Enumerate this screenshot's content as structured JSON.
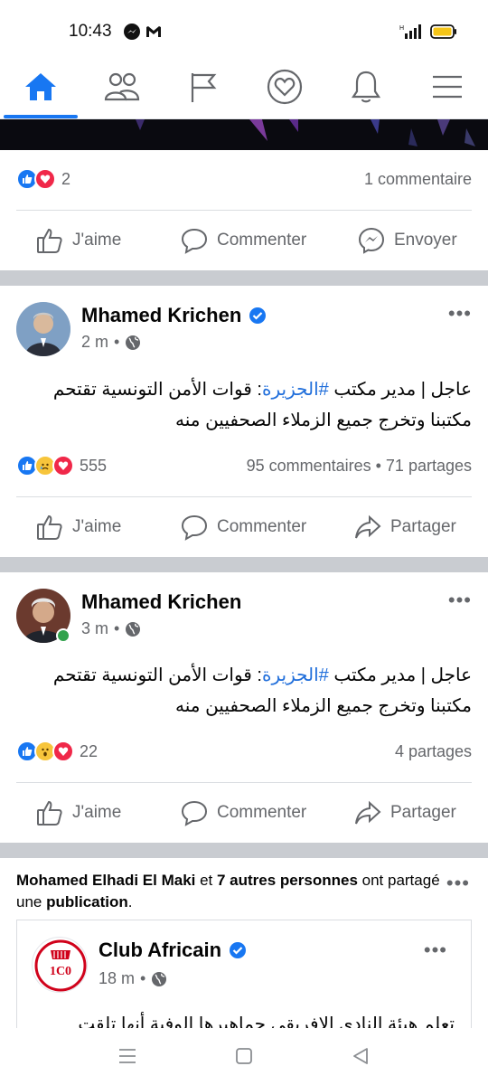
{
  "status_bar": {
    "time": "10:43"
  },
  "nav": {
    "items": [
      {
        "name": "home",
        "active": true
      },
      {
        "name": "friends",
        "active": false
      },
      {
        "name": "pages",
        "active": false
      },
      {
        "name": "dating",
        "active": false
      },
      {
        "name": "notifications",
        "active": false
      },
      {
        "name": "menu",
        "active": false
      }
    ]
  },
  "colors": {
    "accent": "#1877f2",
    "hashtag": "#216fdb",
    "muted": "#65676b",
    "divider": "#c9ccd1"
  },
  "post0": {
    "reaction_count": "2",
    "comments": "1 commentaire",
    "actions": {
      "like": "J'aime",
      "comment": "Commenter",
      "send": "Envoyer"
    }
  },
  "post1": {
    "author": "Mhamed Krichen",
    "verified": true,
    "time": "2 m",
    "sep": "•",
    "text_before": "عاجل | مدير مكتب ",
    "hashtag": "#الجزيرة",
    "text_after": ": قوات الأمن التونسية تقتحم مكتبنا وتخرج جميع الزملاء الصحفيين منه",
    "reaction_count": "555",
    "stats": "95 commentaires • 71 partages",
    "actions": {
      "like": "J'aime",
      "comment": "Commenter",
      "share": "Partager"
    }
  },
  "post2": {
    "author": "Mhamed Krichen",
    "time": "3 m",
    "sep": "•",
    "text_before": "عاجل | مدير مكتب ",
    "hashtag": "#الجزيرة",
    "text_after": ": قوات الأمن التونسية تقتحم مكتبنا وتخرج جميع الزملاء الصحفيين منه",
    "reaction_count": "22",
    "stats": "4 partages",
    "actions": {
      "like": "J'aime",
      "comment": "Commenter",
      "share": "Partager"
    }
  },
  "shared_post": {
    "who": "Mohamed Elhadi El Maki",
    "joiner": " et ",
    "others": "7 autres personnes",
    "verb": " ont partagé une ",
    "object": "publication",
    "end": ".",
    "card": {
      "author": "Club Africain",
      "verified": true,
      "time": "18 m",
      "sep": "•",
      "logo_text": "1C0",
      "text_partial": "تعلم هيئة النادي الافريقي جماهيرها الوفية أنها تلقت"
    }
  }
}
